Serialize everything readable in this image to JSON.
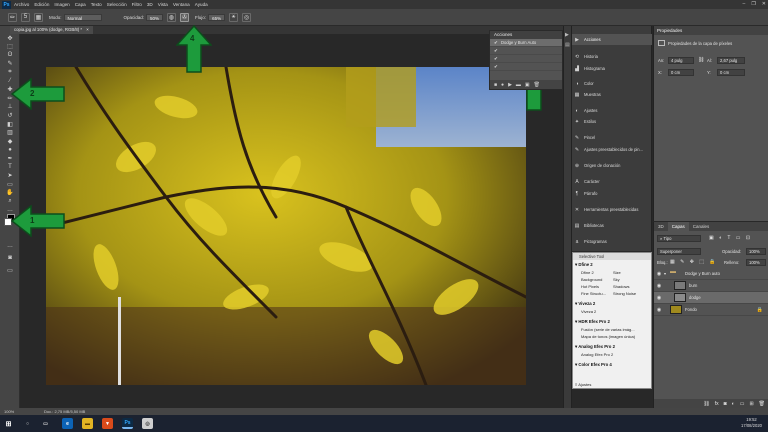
{
  "app": {
    "logo": "Ps"
  },
  "menu": [
    "Archivo",
    "Edición",
    "Imagen",
    "Capa",
    "Texto",
    "Selección",
    "Filtro",
    "3D",
    "Vista",
    "Ventana",
    "Ayuda"
  ],
  "window_controls": [
    "–",
    "❐",
    "✕"
  ],
  "options_bar": {
    "modo_label": "Modo:",
    "modo_value": "Normal",
    "opacidad_label": "Opacidad:",
    "opacidad_value": "50%",
    "flujo_label": "Flujo:",
    "flujo_value": "65%",
    "brush_size": "5"
  },
  "document_tab": {
    "title": "copia.jpg al 100% (dodge, RGB/8) *",
    "close": "×"
  },
  "tools": [
    {
      "icon": "move-icon",
      "glyph": "✥"
    },
    {
      "icon": "marquee-icon",
      "glyph": "⬚"
    },
    {
      "icon": "lasso-icon",
      "glyph": "ʘ"
    },
    {
      "icon": "quick-select-icon",
      "glyph": "✎"
    },
    {
      "icon": "crop-icon",
      "glyph": "⌗"
    },
    {
      "icon": "eyedropper-icon",
      "glyph": "⁄"
    },
    {
      "icon": "healing-icon",
      "glyph": "✚"
    },
    {
      "icon": "brush-icon",
      "glyph": "✏"
    },
    {
      "icon": "stamp-icon",
      "glyph": "⊥"
    },
    {
      "icon": "history-brush-icon",
      "glyph": "↺"
    },
    {
      "icon": "eraser-icon",
      "glyph": "◧"
    },
    {
      "icon": "gradient-icon",
      "glyph": "▥"
    },
    {
      "icon": "blur-icon",
      "glyph": "◆"
    },
    {
      "icon": "dodge-icon",
      "glyph": "●"
    },
    {
      "icon": "pen-icon",
      "glyph": "✒"
    },
    {
      "icon": "type-icon",
      "glyph": "T"
    },
    {
      "icon": "path-select-icon",
      "glyph": "➤"
    },
    {
      "icon": "shape-icon",
      "glyph": "▭"
    },
    {
      "icon": "hand-icon",
      "glyph": "✋"
    },
    {
      "icon": "zoom-icon",
      "glyph": "⌕"
    },
    {
      "icon": "more-icon",
      "glyph": "…"
    }
  ],
  "colors": {
    "accent_arrow": "#1d9b3c",
    "fg": "#ffffff",
    "bg": "#000000"
  },
  "arrows": {
    "n1_tools": "1",
    "n2_tools": "2",
    "n3_actions": "3",
    "n4_options": "4"
  },
  "actions_panel": {
    "title": "Acciones",
    "rows": [
      {
        "check": "✔",
        "label": "Dodge y Burn Auto"
      },
      {
        "check": "✔",
        "label": ""
      },
      {
        "check": "✔",
        "label": ""
      },
      {
        "check": "✔",
        "label": ""
      }
    ],
    "footer": [
      "■",
      "●",
      "▶",
      "▬",
      "▣",
      "🗑"
    ]
  },
  "panel_list": [
    {
      "icon": "actions-icon",
      "glyph": "▶",
      "label": "Acciones",
      "active": true
    },
    {
      "icon": "history-icon",
      "glyph": "⟲",
      "label": "Historia"
    },
    {
      "icon": "histogram-icon",
      "glyph": "▟",
      "label": "Histograma"
    },
    {
      "icon": "color-icon",
      "glyph": "◑",
      "label": "Color"
    },
    {
      "icon": "swatches-icon",
      "glyph": "▦",
      "label": "Muestras"
    },
    {
      "icon": "adjustments-icon",
      "glyph": "◐",
      "label": "Ajustes"
    },
    {
      "icon": "styles-icon",
      "glyph": "✦",
      "label": "Estilos"
    },
    {
      "icon": "brush-panel-icon",
      "glyph": "✎",
      "label": "Pincel"
    },
    {
      "icon": "brush-presets-icon",
      "glyph": "✎",
      "label": "Ajustes preestablecidos de pin..."
    },
    {
      "icon": "clone-source-icon",
      "glyph": "⊕",
      "label": "Origen de clonación"
    },
    {
      "icon": "character-icon",
      "glyph": "A",
      "label": "Carácter"
    },
    {
      "icon": "paragraph-icon",
      "glyph": "¶",
      "label": "Párrafo"
    },
    {
      "icon": "tool-presets-icon",
      "glyph": "✕",
      "label": "Herramientas preestablecidas"
    },
    {
      "icon": "libraries-icon",
      "glyph": "▤",
      "label": "Bibliotecas"
    },
    {
      "icon": "glyphs-icon",
      "glyph": "a",
      "label": "Pictogramas"
    }
  ],
  "properties": {
    "title": "Propiedades",
    "subtitle": "Propiedades de la capa de píxeles",
    "an_label": "An:",
    "an_value": "4 pulg",
    "al_label": "Al:",
    "al_value": "2,67 pulg",
    "x_label": "X:",
    "x_value": "0 cm",
    "y_label": "Y:",
    "y_value": "0 cm"
  },
  "layers": {
    "tabs": [
      "3D",
      "Capas",
      "Canales"
    ],
    "active_tab": 1,
    "filter": "Tipo",
    "blend": "Superponer",
    "opacity_label": "Opacidad:",
    "opacity_value": "100%",
    "lock_label": "Bloq.:",
    "fill_label": "Relleno:",
    "fill_value": "100%",
    "items": [
      {
        "name": "Dodge y Burn auto",
        "kind": "group"
      },
      {
        "name": "burn",
        "kind": "layer"
      },
      {
        "name": "dodge",
        "kind": "layer",
        "selected": true
      },
      {
        "name": "Fondo",
        "kind": "background"
      }
    ]
  },
  "selective_tool": {
    "title": "Selective Tool",
    "sections": [
      {
        "name": "Dfine 2",
        "rows": [
          [
            "Dfine 2",
            "Size"
          ],
          [
            "Background",
            "Sky"
          ],
          [
            "Hot Pixels",
            "Shadows"
          ],
          [
            "Fine Structu...",
            "Strong Noise"
          ]
        ]
      },
      {
        "name": "Viveza 2",
        "rows": [
          [
            "Viveza 2",
            ""
          ]
        ]
      },
      {
        "name": "HDR Efex Pro 2",
        "rows": [
          [
            "Fusión (serie de varias imág...",
            ""
          ],
          [
            "Mapa de tonos (imagen única)",
            ""
          ]
        ]
      },
      {
        "name": "Analog Efex Pro 2",
        "rows": [
          [
            "Analog Efex Pro 2",
            ""
          ]
        ]
      },
      {
        "name": "Color Efex Pro 4",
        "rows": []
      }
    ],
    "footer": "Ajustes"
  },
  "status": {
    "zoom": "100%",
    "doc": "Doc.: 2,75 MB/5,50 MB"
  },
  "taskbar": {
    "time": "19:52",
    "date": "17/08/2020"
  }
}
